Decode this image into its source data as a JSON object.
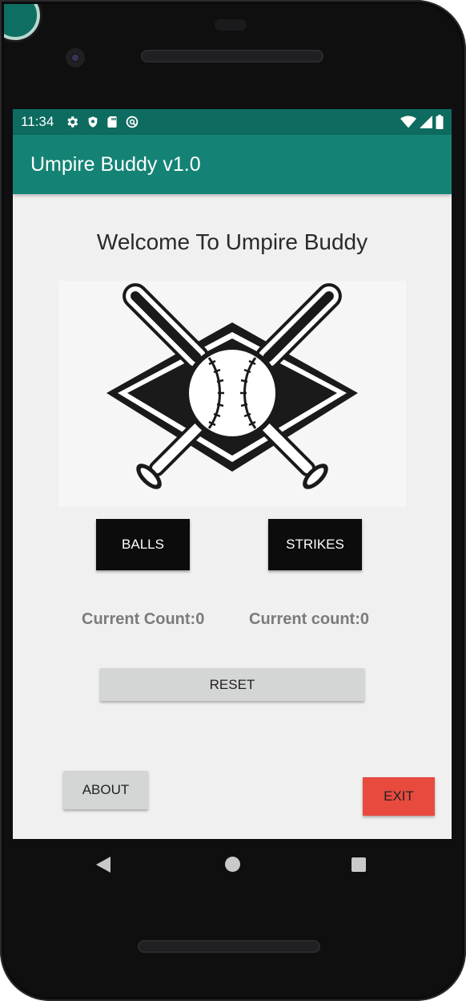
{
  "status_bar": {
    "time": "11:34",
    "left_icons": [
      "gear-icon",
      "shield-icon",
      "sd-card-icon",
      "sync-icon"
    ],
    "right_icons": [
      "wifi-icon",
      "signal-icon",
      "battery-icon"
    ]
  },
  "app_bar": {
    "title": "Umpire Buddy v1.0"
  },
  "main": {
    "welcome": "Welcome To Umpire Buddy",
    "logo_icon": "crossed-bats-baseball-icon",
    "balls_label": "BALLS",
    "strikes_label": "STRIKES",
    "balls_count": "Current Count:0",
    "strikes_count": "Current count:0",
    "reset_label": "RESET",
    "about_label": "ABOUT",
    "exit_label": "EXIT"
  },
  "colors": {
    "status_bar": "#0d6b5f",
    "app_bar": "#148375",
    "exit": "#e84a3e",
    "dark_button": "#0c0c0c",
    "gray_button": "#d4d5d5"
  },
  "nav_bar": {
    "icons": [
      "back-icon",
      "home-icon",
      "recents-icon"
    ]
  }
}
